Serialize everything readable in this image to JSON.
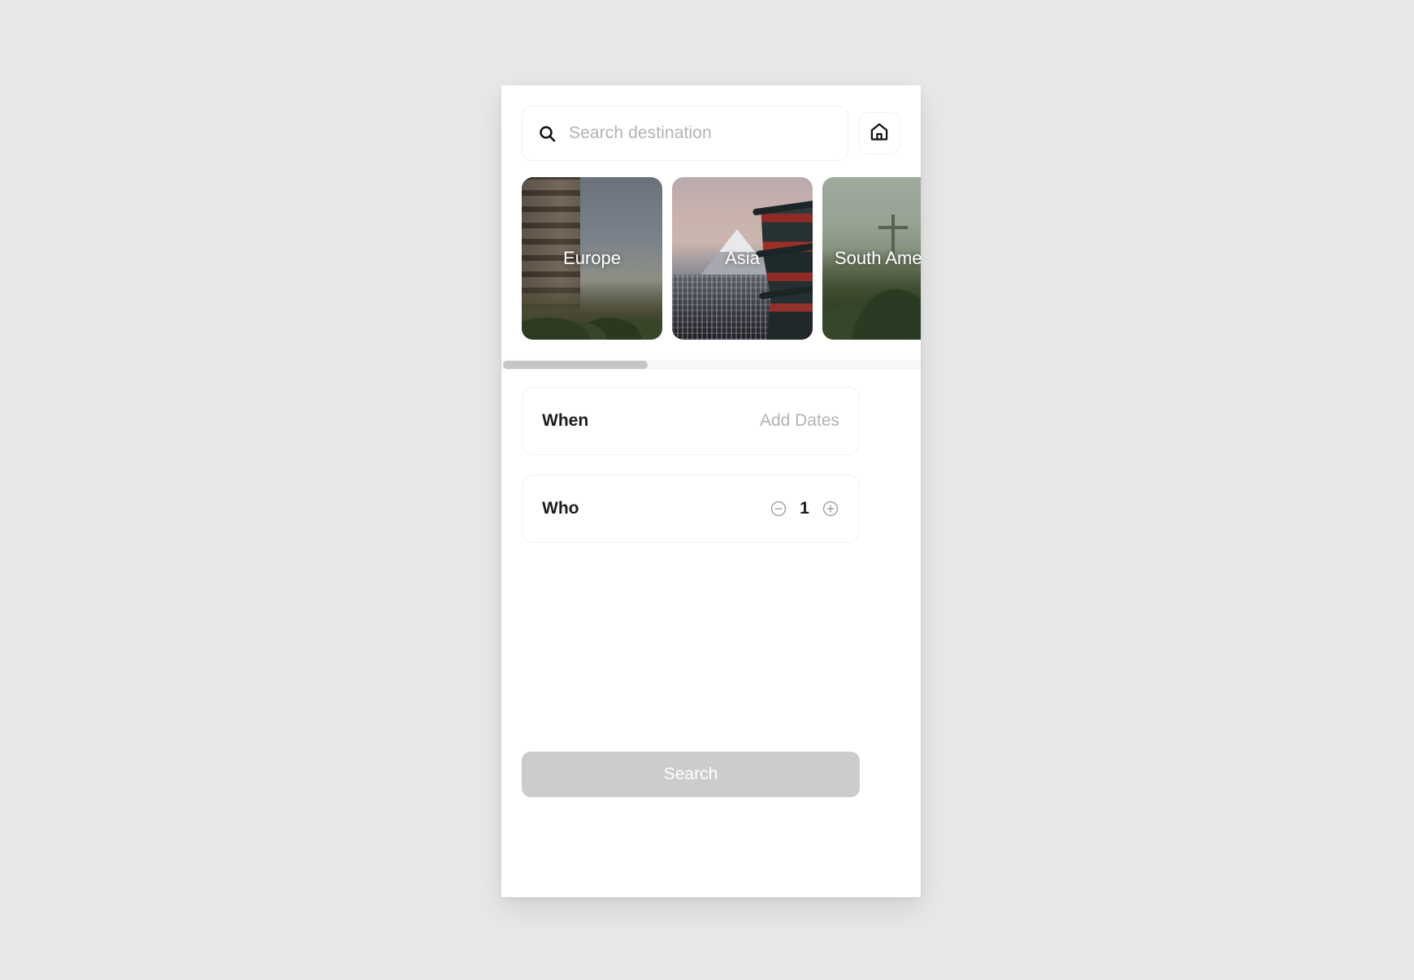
{
  "theme": {
    "page_background": "#e8e8e8",
    "panel_background": "#ffffff",
    "text_primary": "#1c1c1c",
    "text_muted": "#b3b3b3",
    "disabled_button": "#cccccc",
    "scrollbar_thumb": "#c6c6c6",
    "scrollbar_track": "#f7f7f7"
  },
  "search": {
    "placeholder": "Search destination",
    "value": "",
    "icon": "search-icon",
    "home_icon": "home-icon"
  },
  "destinations": {
    "items": [
      {
        "label": "Europe",
        "art": "colosseum"
      },
      {
        "label": "Asia",
        "art": "mount-fuji-pagoda"
      },
      {
        "label": "South America",
        "art": "christ-the-redeemer"
      }
    ]
  },
  "options": {
    "when": {
      "title": "When",
      "value": "Add Dates"
    },
    "who": {
      "title": "Who",
      "count": "1",
      "decrement_icon": "minus-circle-icon",
      "increment_icon": "plus-circle-icon"
    }
  },
  "footer": {
    "search_label": "Search",
    "search_enabled": false
  }
}
